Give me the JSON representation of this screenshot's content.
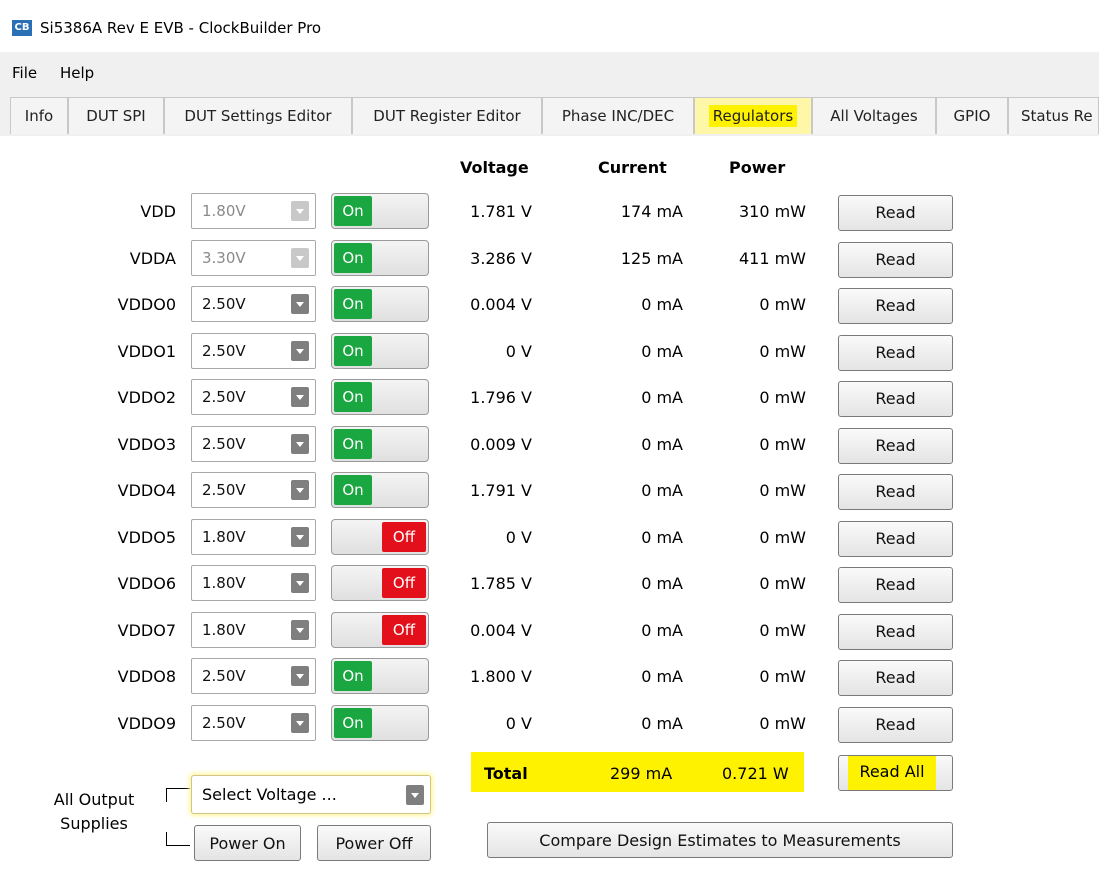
{
  "window": {
    "app_icon": "CB",
    "title": "Si5386A Rev E EVB - ClockBuilder Pro"
  },
  "menu": {
    "file": "File",
    "help": "Help"
  },
  "tabs": [
    {
      "label": "Info"
    },
    {
      "label": "DUT SPI"
    },
    {
      "label": "DUT Settings Editor"
    },
    {
      "label": "DUT Register Editor"
    },
    {
      "label": "Phase INC/DEC"
    },
    {
      "label": "Regulators"
    },
    {
      "label": "All Voltages"
    },
    {
      "label": "GPIO"
    },
    {
      "label": "Status Re"
    }
  ],
  "active_tab": "Regulators",
  "headers": {
    "voltage": "Voltage",
    "current": "Current",
    "power": "Power"
  },
  "rows": [
    {
      "name": "VDD",
      "setting": "1.80V",
      "enabled": false,
      "state": "On",
      "voltage": "1.781 V",
      "current": "174 mA",
      "power": "310 mW",
      "read": "Read"
    },
    {
      "name": "VDDA",
      "setting": "3.30V",
      "enabled": false,
      "state": "On",
      "voltage": "3.286 V",
      "current": "125 mA",
      "power": "411 mW",
      "read": "Read"
    },
    {
      "name": "VDDO0",
      "setting": "2.50V",
      "enabled": true,
      "state": "On",
      "voltage": "0.004 V",
      "current": "0 mA",
      "power": "0 mW",
      "read": "Read"
    },
    {
      "name": "VDDO1",
      "setting": "2.50V",
      "enabled": true,
      "state": "On",
      "voltage": "0 V",
      "current": "0 mA",
      "power": "0 mW",
      "read": "Read"
    },
    {
      "name": "VDDO2",
      "setting": "2.50V",
      "enabled": true,
      "state": "On",
      "voltage": "1.796 V",
      "current": "0 mA",
      "power": "0 mW",
      "read": "Read"
    },
    {
      "name": "VDDO3",
      "setting": "2.50V",
      "enabled": true,
      "state": "On",
      "voltage": "0.009 V",
      "current": "0 mA",
      "power": "0 mW",
      "read": "Read"
    },
    {
      "name": "VDDO4",
      "setting": "2.50V",
      "enabled": true,
      "state": "On",
      "voltage": "1.791 V",
      "current": "0 mA",
      "power": "0 mW",
      "read": "Read"
    },
    {
      "name": "VDDO5",
      "setting": "1.80V",
      "enabled": true,
      "state": "Off",
      "voltage": "0 V",
      "current": "0 mA",
      "power": "0 mW",
      "read": "Read"
    },
    {
      "name": "VDDO6",
      "setting": "1.80V",
      "enabled": true,
      "state": "Off",
      "voltage": "1.785 V",
      "current": "0 mA",
      "power": "0 mW",
      "read": "Read"
    },
    {
      "name": "VDDO7",
      "setting": "1.80V",
      "enabled": true,
      "state": "Off",
      "voltage": "0.004 V",
      "current": "0 mA",
      "power": "0 mW",
      "read": "Read"
    },
    {
      "name": "VDDO8",
      "setting": "2.50V",
      "enabled": true,
      "state": "On",
      "voltage": "1.800 V",
      "current": "0 mA",
      "power": "0 mW",
      "read": "Read"
    },
    {
      "name": "VDDO9",
      "setting": "2.50V",
      "enabled": true,
      "state": "On",
      "voltage": "0 V",
      "current": "0 mA",
      "power": "0 mW",
      "read": "Read"
    }
  ],
  "totals": {
    "label": "Total",
    "current": "299 mA",
    "power": "0.721 W",
    "read_all": "Read All"
  },
  "all_outputs": {
    "label_line1": "All Output",
    "label_line2": "Supplies",
    "select_placeholder": "Select Voltage ...",
    "power_on": "Power On",
    "power_off": "Power Off"
  },
  "compare_button": "Compare Design Estimates to Measurements",
  "colors": {
    "highlight": "#fff200",
    "on_green": "#1aa640",
    "off_red": "#e3101c"
  }
}
